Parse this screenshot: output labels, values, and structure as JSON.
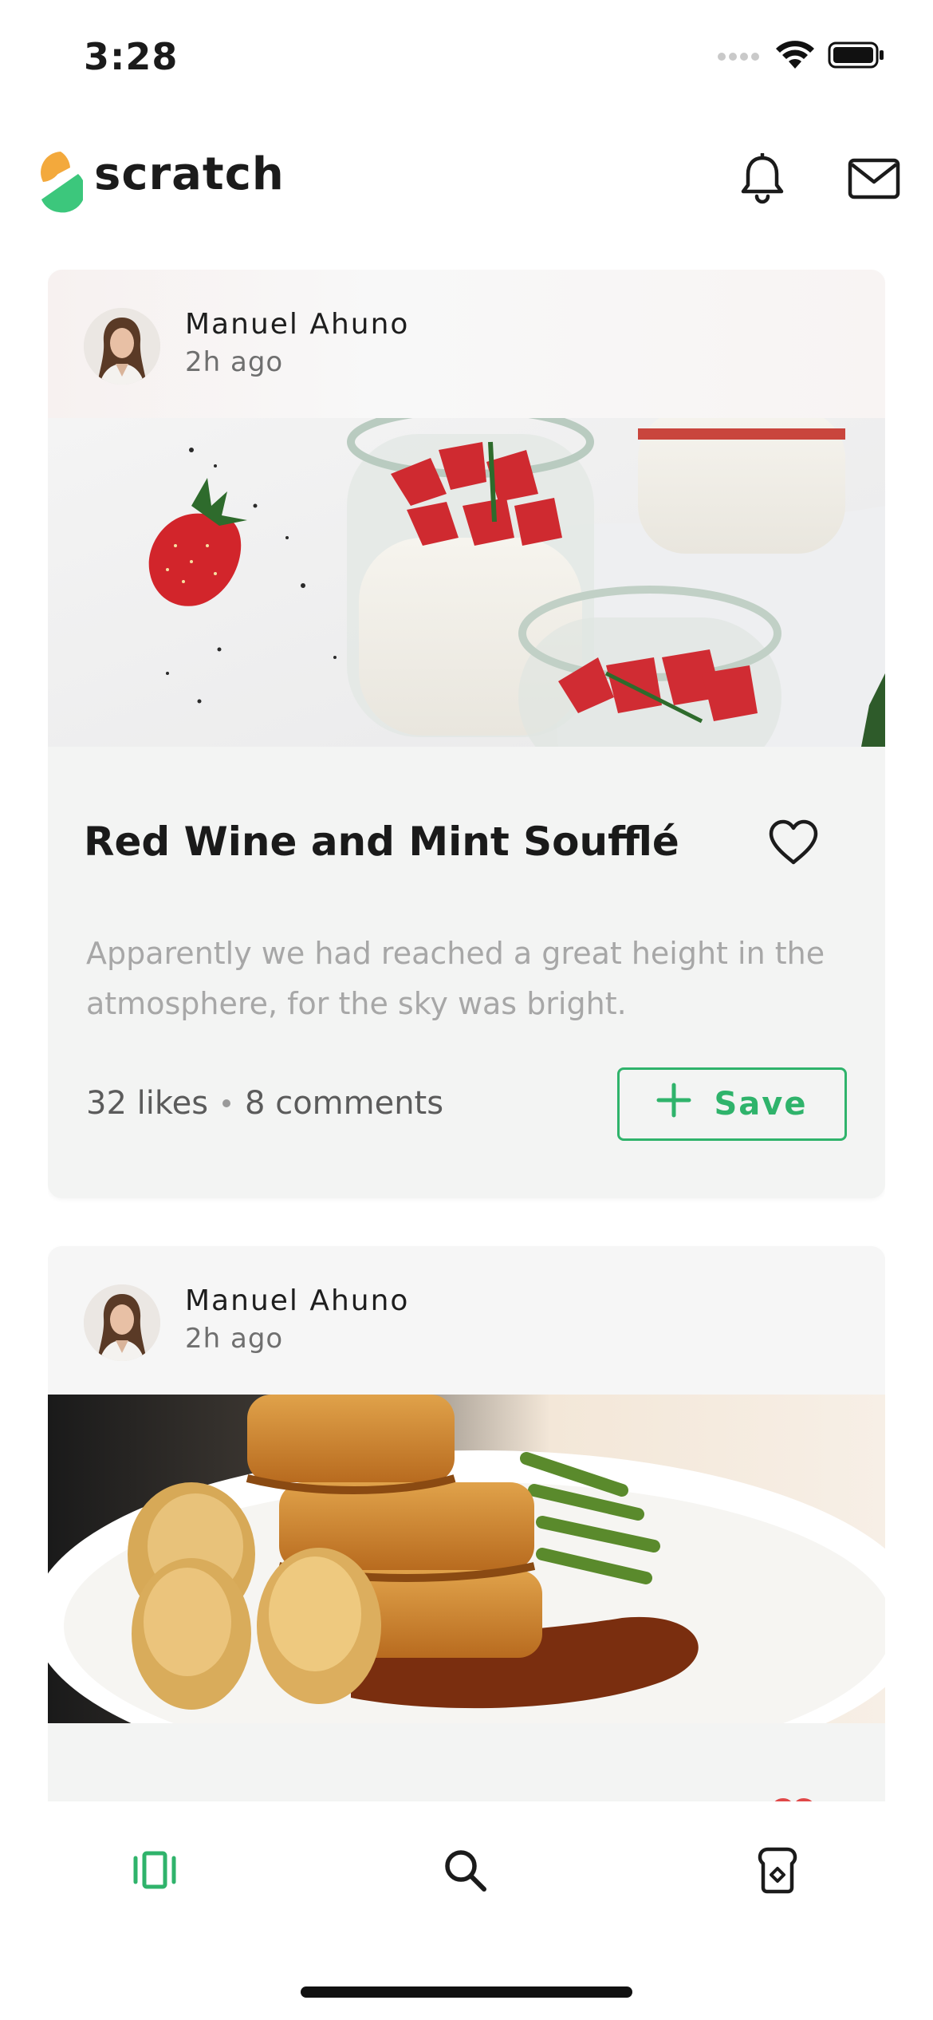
{
  "status_bar": {
    "time": "3:28",
    "icons": [
      "cellular-signal-icon",
      "wifi-icon",
      "battery-icon"
    ]
  },
  "header": {
    "app_name": "scratch",
    "actions": [
      "bell-icon",
      "mail-icon"
    ]
  },
  "colors": {
    "accent_green": "#2fb36b",
    "logo_orange": "#f3a93c",
    "logo_green": "#3cc77c"
  },
  "feed": [
    {
      "author": "Manuel Ahuno",
      "time": "2h ago",
      "title": "Red Wine and Mint Soufflé",
      "description": "Apparently we had reached a great height in the atmosphere, for the sky was bright.",
      "likes": "32 likes",
      "comments": "8 comments",
      "save_label": "Save",
      "liked": false
    },
    {
      "author": "Manuel Ahuno",
      "time": "2h ago",
      "liked": true
    }
  ],
  "bottom_nav": {
    "items": [
      "feed-icon",
      "search-icon",
      "saved-recipes-icon"
    ],
    "active": "feed-icon"
  }
}
